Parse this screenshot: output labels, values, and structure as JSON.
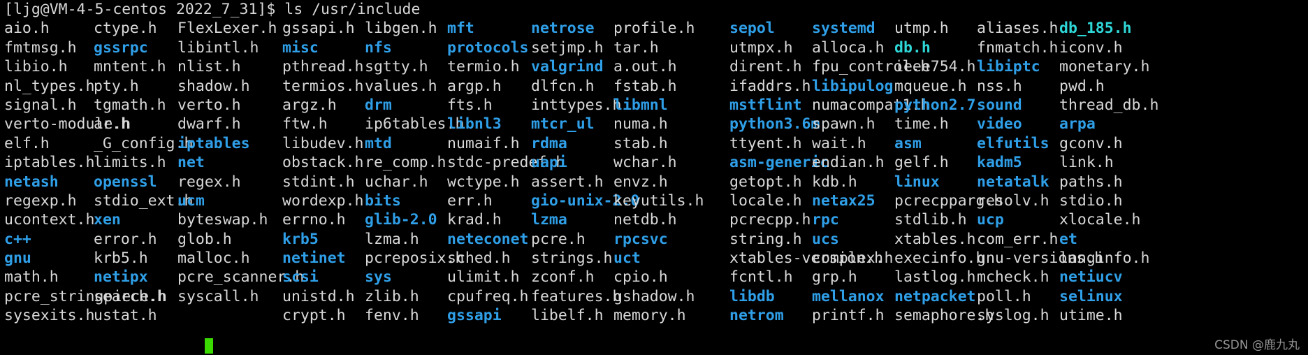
{
  "terminal": {
    "prompt": "[ljg@VM-4-5-centos 2022_7_31]$",
    "command": "ls /usr/include",
    "prompt_line": "[ljg@VM-4-5-centos 2022_7_31]$ ls /usr/include",
    "colors": {
      "background": "#000000",
      "file_text": "#d8d8d8",
      "directory_text": "#2f9fe8",
      "archive_text": "#2fd8d8",
      "cursor": "#3ad900"
    },
    "cursor_visible": true
  },
  "watermark": "CSDN @鹿九丸",
  "listing": {
    "rows": 14,
    "columns": 13,
    "entries": [
      [
        {
          "name": "aio.h",
          "type": "file"
        },
        {
          "name": "ctype.h",
          "type": "file"
        },
        {
          "name": "FlexLexer.h",
          "type": "file"
        },
        {
          "name": "gssapi.h",
          "type": "file"
        },
        {
          "name": "libgen.h",
          "type": "file"
        },
        {
          "name": "mft",
          "type": "dir"
        },
        {
          "name": "netrose",
          "type": "dir"
        },
        {
          "name": "profile.h",
          "type": "file"
        },
        {
          "name": "sepol",
          "type": "dir"
        },
        {
          "name": "systemd",
          "type": "dir"
        },
        {
          "name": "utmp.h",
          "type": "file"
        }
      ],
      [
        {
          "name": "aliases.h",
          "type": "file"
        },
        {
          "name": "db_185.h",
          "type": "arch"
        },
        {
          "name": "fmtmsg.h",
          "type": "file"
        },
        {
          "name": "gssrpc",
          "type": "dir"
        },
        {
          "name": "libintl.h",
          "type": "file"
        },
        {
          "name": "misc",
          "type": "dir"
        },
        {
          "name": "nfs",
          "type": "dir"
        },
        {
          "name": "protocols",
          "type": "dir"
        },
        {
          "name": "setjmp.h",
          "type": "file"
        },
        {
          "name": "tar.h",
          "type": "file"
        },
        {
          "name": "utmpx.h",
          "type": "file"
        }
      ],
      [
        {
          "name": "alloca.h",
          "type": "file"
        },
        {
          "name": "db.h",
          "type": "arch"
        },
        {
          "name": "fnmatch.h",
          "type": "file"
        },
        {
          "name": "iconv.h",
          "type": "file"
        },
        {
          "name": "libio.h",
          "type": "file"
        },
        {
          "name": "mntent.h",
          "type": "file"
        },
        {
          "name": "nlist.h",
          "type": "file"
        },
        {
          "name": "pthread.h",
          "type": "file"
        },
        {
          "name": "sgtty.h",
          "type": "file"
        },
        {
          "name": "termio.h",
          "type": "file"
        },
        {
          "name": "valgrind",
          "type": "dir"
        }
      ],
      [
        {
          "name": "a.out.h",
          "type": "file"
        },
        {
          "name": "dirent.h",
          "type": "file"
        },
        {
          "name": "fpu_control.h",
          "type": "file"
        },
        {
          "name": "ieee754.h",
          "type": "file"
        },
        {
          "name": "libiptc",
          "type": "dir"
        },
        {
          "name": "monetary.h",
          "type": "file"
        },
        {
          "name": "nl_types.h",
          "type": "file"
        },
        {
          "name": "pty.h",
          "type": "file"
        },
        {
          "name": "shadow.h",
          "type": "file"
        },
        {
          "name": "termios.h",
          "type": "file"
        },
        {
          "name": "values.h",
          "type": "file"
        }
      ],
      [
        {
          "name": "argp.h",
          "type": "file"
        },
        {
          "name": "dlfcn.h",
          "type": "file"
        },
        {
          "name": "fstab.h",
          "type": "file"
        },
        {
          "name": "ifaddrs.h",
          "type": "file"
        },
        {
          "name": "libipulog",
          "type": "dir"
        },
        {
          "name": "mqueue.h",
          "type": "file"
        },
        {
          "name": "nss.h",
          "type": "file"
        },
        {
          "name": "pwd.h",
          "type": "file"
        },
        {
          "name": "signal.h",
          "type": "file"
        },
        {
          "name": "tgmath.h",
          "type": "file"
        },
        {
          "name": "verto.h",
          "type": "file"
        }
      ],
      [
        {
          "name": "argz.h",
          "type": "file"
        },
        {
          "name": "drm",
          "type": "dir"
        },
        {
          "name": "fts.h",
          "type": "file"
        },
        {
          "name": "inttypes.h",
          "type": "file"
        },
        {
          "name": "libmnl",
          "type": "dir"
        },
        {
          "name": "mstflint",
          "type": "dir"
        },
        {
          "name": "numacompat1.h",
          "type": "file"
        },
        {
          "name": "python2.7",
          "type": "dir"
        },
        {
          "name": "sound",
          "type": "dir"
        },
        {
          "name": "thread_db.h",
          "type": "file"
        },
        {
          "name": "verto-module.h",
          "type": "file"
        }
      ],
      [
        {
          "name": "ar.h",
          "type": "file"
        },
        {
          "name": "dwarf.h",
          "type": "file"
        },
        {
          "name": "ftw.h",
          "type": "file"
        },
        {
          "name": "ip6tables.h",
          "type": "file"
        },
        {
          "name": "libnl3",
          "type": "dir"
        },
        {
          "name": "mtcr_ul",
          "type": "dir"
        },
        {
          "name": "numa.h",
          "type": "file"
        },
        {
          "name": "python3.6m",
          "type": "dir"
        },
        {
          "name": "spawn.h",
          "type": "file"
        },
        {
          "name": "time.h",
          "type": "file"
        },
        {
          "name": "video",
          "type": "dir"
        }
      ],
      [
        {
          "name": "arpa",
          "type": "dir"
        },
        {
          "name": "elf.h",
          "type": "file"
        },
        {
          "name": "_G_config.h",
          "type": "file"
        },
        {
          "name": "iptables",
          "type": "dir"
        },
        {
          "name": "libudev.h",
          "type": "file"
        },
        {
          "name": "mtd",
          "type": "dir"
        },
        {
          "name": "numaif.h",
          "type": "file"
        },
        {
          "name": "rdma",
          "type": "dir"
        },
        {
          "name": "stab.h",
          "type": "file"
        },
        {
          "name": "ttyent.h",
          "type": "file"
        },
        {
          "name": "wait.h",
          "type": "file"
        }
      ],
      [
        {
          "name": "asm",
          "type": "dir"
        },
        {
          "name": "elfutils",
          "type": "dir"
        },
        {
          "name": "gconv.h",
          "type": "file"
        },
        {
          "name": "iptables.h",
          "type": "file"
        },
        {
          "name": "limits.h",
          "type": "file"
        },
        {
          "name": "net",
          "type": "dir"
        },
        {
          "name": "obstack.h",
          "type": "file"
        },
        {
          "name": "re_comp.h",
          "type": "file"
        },
        {
          "name": "stdc-predef.h",
          "type": "file"
        },
        {
          "name": "uapi",
          "type": "dir"
        },
        {
          "name": "wchar.h",
          "type": "file"
        }
      ],
      [
        {
          "name": "asm-generic",
          "type": "dir"
        },
        {
          "name": "endian.h",
          "type": "file"
        },
        {
          "name": "gelf.h",
          "type": "file"
        },
        {
          "name": "kadm5",
          "type": "dir"
        },
        {
          "name": "link.h",
          "type": "file"
        },
        {
          "name": "netash",
          "type": "dir"
        },
        {
          "name": "openssl",
          "type": "dir"
        },
        {
          "name": "regex.h",
          "type": "file"
        },
        {
          "name": "stdint.h",
          "type": "file"
        },
        {
          "name": "uchar.h",
          "type": "file"
        },
        {
          "name": "wctype.h",
          "type": "file"
        }
      ],
      [
        {
          "name": "assert.h",
          "type": "file"
        },
        {
          "name": "envz.h",
          "type": "file"
        },
        {
          "name": "getopt.h",
          "type": "file"
        },
        {
          "name": "kdb.h",
          "type": "file"
        },
        {
          "name": "linux",
          "type": "dir"
        },
        {
          "name": "netatalk",
          "type": "dir"
        },
        {
          "name": "paths.h",
          "type": "file"
        },
        {
          "name": "regexp.h",
          "type": "file"
        },
        {
          "name": "stdio_ext.h",
          "type": "file"
        },
        {
          "name": "ucm",
          "type": "dir"
        },
        {
          "name": "wordexp.h",
          "type": "file"
        }
      ],
      [
        {
          "name": "bits",
          "type": "dir"
        },
        {
          "name": "err.h",
          "type": "file"
        },
        {
          "name": "gio-unix-2.0",
          "type": "dir"
        },
        {
          "name": "keyutils.h",
          "type": "file"
        },
        {
          "name": "locale.h",
          "type": "file"
        },
        {
          "name": "netax25",
          "type": "dir"
        },
        {
          "name": "pcrecpparg.h",
          "type": "file"
        },
        {
          "name": "resolv.h",
          "type": "file"
        },
        {
          "name": "stdio.h",
          "type": "file"
        },
        {
          "name": "ucontext.h",
          "type": "file"
        },
        {
          "name": "xen",
          "type": "dir"
        }
      ],
      [
        {
          "name": "byteswap.h",
          "type": "file"
        },
        {
          "name": "errno.h",
          "type": "file"
        },
        {
          "name": "glib-2.0",
          "type": "dir"
        },
        {
          "name": "krad.h",
          "type": "file"
        },
        {
          "name": "lzma",
          "type": "dir"
        },
        {
          "name": "netdb.h",
          "type": "file"
        },
        {
          "name": "pcrecpp.h",
          "type": "file"
        },
        {
          "name": "rpc",
          "type": "dir"
        },
        {
          "name": "stdlib.h",
          "type": "file"
        },
        {
          "name": "ucp",
          "type": "dir"
        },
        {
          "name": "xlocale.h",
          "type": "file"
        }
      ],
      [
        {
          "name": "c++",
          "type": "dir"
        },
        {
          "name": "error.h",
          "type": "file"
        },
        {
          "name": "glob.h",
          "type": "file"
        },
        {
          "name": "krb5",
          "type": "dir"
        },
        {
          "name": "lzma.h",
          "type": "file"
        },
        {
          "name": "neteconet",
          "type": "dir"
        },
        {
          "name": "pcre.h",
          "type": "file"
        },
        {
          "name": "rpcsvc",
          "type": "dir"
        },
        {
          "name": "string.h",
          "type": "file"
        },
        {
          "name": "ucs",
          "type": "dir"
        },
        {
          "name": "xtables.h",
          "type": "file"
        }
      ],
      [
        {
          "name": "com_err.h",
          "type": "file"
        },
        {
          "name": "et",
          "type": "dir"
        },
        {
          "name": "gnu",
          "type": "dir"
        },
        {
          "name": "krb5.h",
          "type": "file"
        },
        {
          "name": "malloc.h",
          "type": "file"
        },
        {
          "name": "netinet",
          "type": "dir"
        },
        {
          "name": "pcreposix.h",
          "type": "file"
        },
        {
          "name": "sched.h",
          "type": "file"
        },
        {
          "name": "strings.h",
          "type": "file"
        },
        {
          "name": "uct",
          "type": "dir"
        },
        {
          "name": "xtables-version.h",
          "type": "file"
        }
      ],
      [
        {
          "name": "complex.h",
          "type": "file"
        },
        {
          "name": "execinfo.h",
          "type": "file"
        },
        {
          "name": "gnu-versions.h",
          "type": "file"
        },
        {
          "name": "langinfo.h",
          "type": "file"
        },
        {
          "name": "math.h",
          "type": "file"
        },
        {
          "name": "netipx",
          "type": "dir"
        },
        {
          "name": "pcre_scanner.h",
          "type": "file"
        },
        {
          "name": "scsi",
          "type": "dir"
        },
        {
          "name": "sys",
          "type": "dir"
        },
        {
          "name": "ulimit.h",
          "type": "file"
        },
        {
          "name": "zconf.h",
          "type": "file"
        }
      ],
      [
        {
          "name": "cpio.h",
          "type": "file"
        },
        {
          "name": "fcntl.h",
          "type": "file"
        },
        {
          "name": "grp.h",
          "type": "file"
        },
        {
          "name": "lastlog.h",
          "type": "file"
        },
        {
          "name": "mcheck.h",
          "type": "file"
        },
        {
          "name": "netiucv",
          "type": "dir"
        },
        {
          "name": "pcre_stringpiece.h",
          "type": "file"
        },
        {
          "name": "search.h",
          "type": "file"
        },
        {
          "name": "syscall.h",
          "type": "file"
        },
        {
          "name": "unistd.h",
          "type": "file"
        },
        {
          "name": "zlib.h",
          "type": "file"
        }
      ],
      [
        {
          "name": "cpufreq.h",
          "type": "file"
        },
        {
          "name": "features.h",
          "type": "file"
        },
        {
          "name": "gshadow.h",
          "type": "file"
        },
        {
          "name": "libdb",
          "type": "dir"
        },
        {
          "name": "mellanox",
          "type": "dir"
        },
        {
          "name": "netpacket",
          "type": "dir"
        },
        {
          "name": "poll.h",
          "type": "file"
        },
        {
          "name": "selinux",
          "type": "dir"
        },
        {
          "name": "sysexits.h",
          "type": "file"
        },
        {
          "name": "ustat.h",
          "type": "file"
        },
        {
          "name": "",
          "type": "file"
        }
      ],
      [
        {
          "name": "crypt.h",
          "type": "file"
        },
        {
          "name": "fenv.h",
          "type": "file"
        },
        {
          "name": "gssapi",
          "type": "dir"
        },
        {
          "name": "libelf.h",
          "type": "file"
        },
        {
          "name": "memory.h",
          "type": "file"
        },
        {
          "name": "netrom",
          "type": "dir"
        },
        {
          "name": "printf.h",
          "type": "file"
        },
        {
          "name": "semaphore.h",
          "type": "file"
        },
        {
          "name": "syslog.h",
          "type": "file"
        },
        {
          "name": "utime.h",
          "type": "file"
        },
        {
          "name": "",
          "type": "file"
        }
      ]
    ]
  }
}
